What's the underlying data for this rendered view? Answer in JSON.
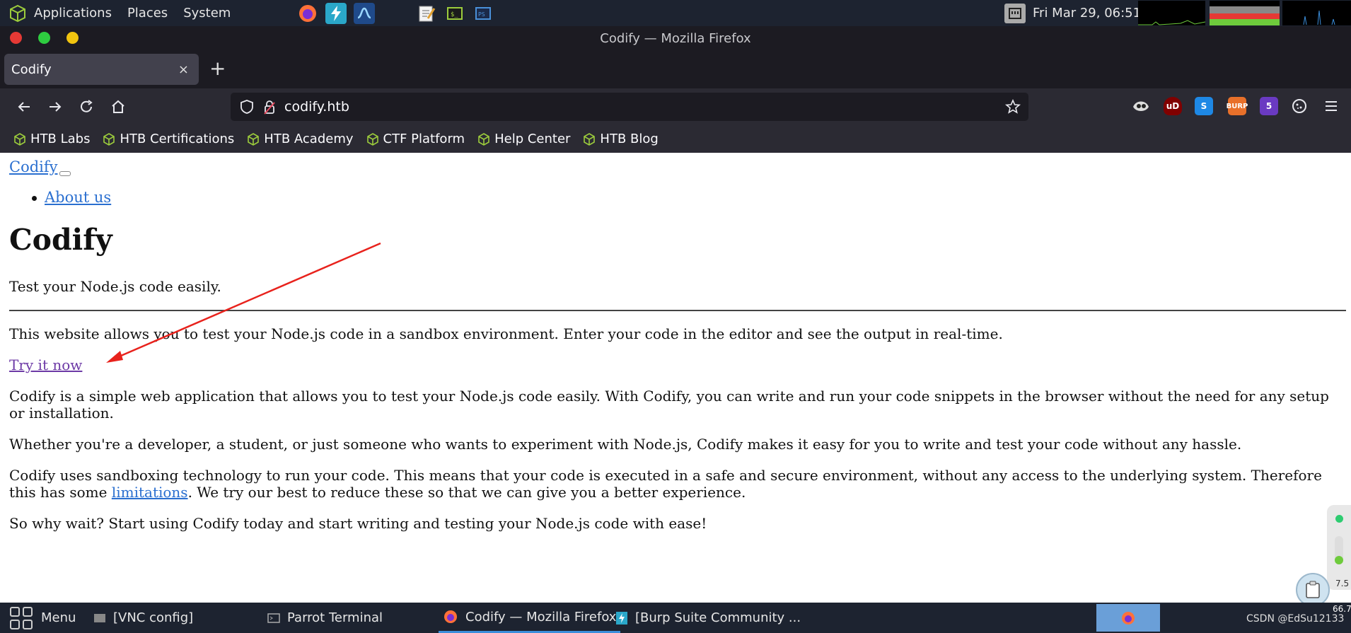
{
  "system_panel": {
    "menus": [
      "Applications",
      "Places",
      "System"
    ],
    "clock": "Fri Mar 29, 06:51"
  },
  "window": {
    "title": "Codify — Mozilla Firefox"
  },
  "tabs": [
    {
      "label": "Codify",
      "close": "×"
    }
  ],
  "newtab_label": "+",
  "urlbar": {
    "url": "codify.htb"
  },
  "extensions": [
    {
      "icon": "ublock-icon",
      "text": "uD",
      "color": "#800000"
    },
    {
      "icon": "s-extension-icon",
      "text": "S",
      "color": "#1e88e5"
    },
    {
      "icon": "burp-icon",
      "text": "BURP",
      "color": "#e8702a"
    },
    {
      "icon": "foxyproxy-icon",
      "text": "5",
      "color": "#6a3ac2"
    }
  ],
  "bookmarks": [
    "HTB Labs",
    "HTB Certifications",
    "HTB Academy",
    "CTF Platform",
    "Help Center",
    "HTB Blog"
  ],
  "page": {
    "brand": "Codify",
    "nav_items": [
      "About us"
    ],
    "heading": "Codify",
    "lead": "Test your Node.js code easily.",
    "intro": "This website allows you to test your Node.js code in a sandbox environment. Enter your code in the editor and see the output in real-time.",
    "cta": "Try it now",
    "p1": "Codify is a simple web application that allows you to test your Node.js code easily. With Codify, you can write and run your code snippets in the browser without the need for any setup or installation.",
    "p2": "Whether you're a developer, a student, or just someone who wants to experiment with Node.js, Codify makes it easy for you to write and test your code without any hassle.",
    "p3_before": "Codify uses sandboxing technology to run your code. This means that your code is executed in a safe and secure environment, without any access to the underlying system. Therefore this has some ",
    "p3_link": "limitations",
    "p3_after": ". We try our best to reduce these so that we can give you a better experience.",
    "p4": "So why wait? Start using Codify today and start writing and testing your Node.js code with ease!"
  },
  "taskbar": {
    "menu": "Menu",
    "items": [
      "[VNC config]",
      "Parrot Terminal",
      "Codify — Mozilla Firefox",
      "[Burp Suite Community ..."
    ],
    "watermark": "CSDN @EdSu12133",
    "net_up": "7.5",
    "net_down": "66.7"
  }
}
